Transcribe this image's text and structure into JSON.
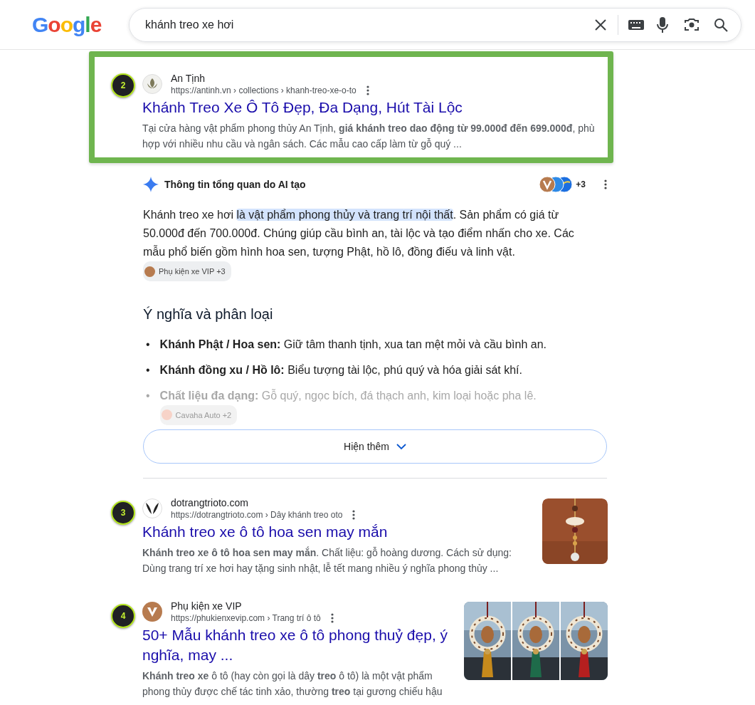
{
  "header": {
    "logo": "Google",
    "search": {
      "value": "khánh treo xe hơi"
    }
  },
  "items": [
    {
      "kind": "result",
      "marker": "2",
      "highlighted": true,
      "site": "An Tịnh",
      "url": "https://antinh.vn › collections › khanh-treo-xe-o-to",
      "title": "Khánh Treo Xe Ô Tô Đẹp, Đa Dạng, Hút Tài Lộc",
      "snippet": "Tại cửa hàng vật phẩm phong thủy An Tịnh, **giá khánh treo dao động từ 99.000đ đến 699.000đ**, phù hợp với nhiều nhu cầu và ngân sách. Các mẫu cao cấp làm từ gỗ quý ..."
    },
    {
      "kind": "overview",
      "title": "Thông tin tổng quan do AI tạo",
      "sources_more": "+3",
      "paragraph": {
        "before": "Khánh treo xe hơi ",
        "highlight": "là vật phẩm phong thủy và trang trí nội thất",
        "after": ". Sản phẩm có giá từ 50.000đ đến 700.000đ. Chúng giúp cầu bình an, tài lộc và tạo điểm nhấn cho xe. Các mẫu phổ biến gồm hình hoa sen, tượng Phật, hồ lô, đồng điếu và linh vật.",
        "chip": "Phụ kiện xe VIP +3"
      },
      "heading": "Ý nghĩa và phân loại",
      "bullets": [
        {
          "marker": "•",
          "term": "Khánh Phật / Hoa sen:",
          "text": " Giữ tâm thanh tịnh, xua tan mệt mỏi và cầu bình an.",
          "faded": false
        },
        {
          "marker": "•",
          "term": "Khánh đồng xu / Hồ lô:",
          "text": " Biểu tượng tài lộc, phú quý và hóa giải sát khí.",
          "faded": false
        },
        {
          "marker": "•",
          "term": "Chất liệu đa dạng:",
          "text": " Gỗ quý, ngọc bích, đá thạch anh, kim loại hoặc pha lê.",
          "chip": "Cavaha Auto +2",
          "faded": true
        }
      ],
      "more_button": "Hiện thêm"
    },
    {
      "kind": "result",
      "marker": "3",
      "highlighted": false,
      "site": "dotrangtrioto.com",
      "url": "https://dotrangtrioto.com › Dây khánh treo oto",
      "title": "Khánh treo xe ô tô hoa sen may mắn",
      "snippet": "**Khánh treo xe ô tô hoa sen may mắn**. Chất liệu: gỗ hoàng dương. Cách sử dụng: Dùng trang trí xe hơi hay tặng sinh nhật, lễ tết mang nhiều ý nghĩa phong thủy ..."
    },
    {
      "kind": "result",
      "marker": "4",
      "highlighted": false,
      "site": "Phụ kiện xe VIP",
      "url": "https://phukienxevip.com › Trang trí ô tô",
      "title": "50+ Mẫu khánh treo xe ô tô phong thuỷ đẹp, ý nghĩa, may ...",
      "snippet": "**Khánh treo xe** ô tô (hay còn gọi là dây **treo** ô tô) là một vật phẩm phong thủy được chế tác tinh xảo, thường **treo** tại gương chiếu hậu"
    }
  ]
}
